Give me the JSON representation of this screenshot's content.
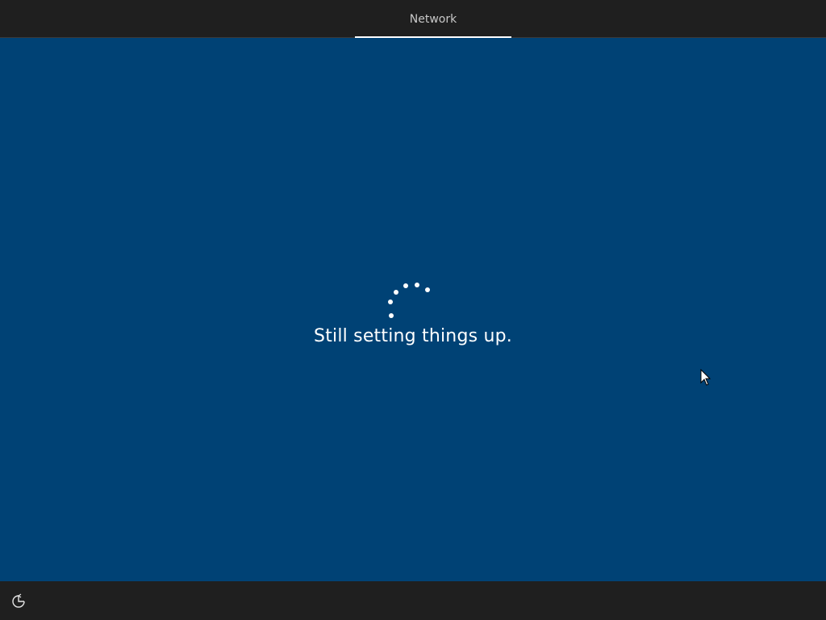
{
  "topbar": {
    "tabs": [
      {
        "label": "Network",
        "active": true
      }
    ]
  },
  "main": {
    "status": "Still setting things up.",
    "background_color": "#004275"
  },
  "bottombar": {
    "ease_of_access_icon": "ease-of-access-icon"
  },
  "colors": {
    "bar": "#1f1f1f",
    "accent": "#ffffff",
    "tab_text": "#c8c8c8"
  }
}
